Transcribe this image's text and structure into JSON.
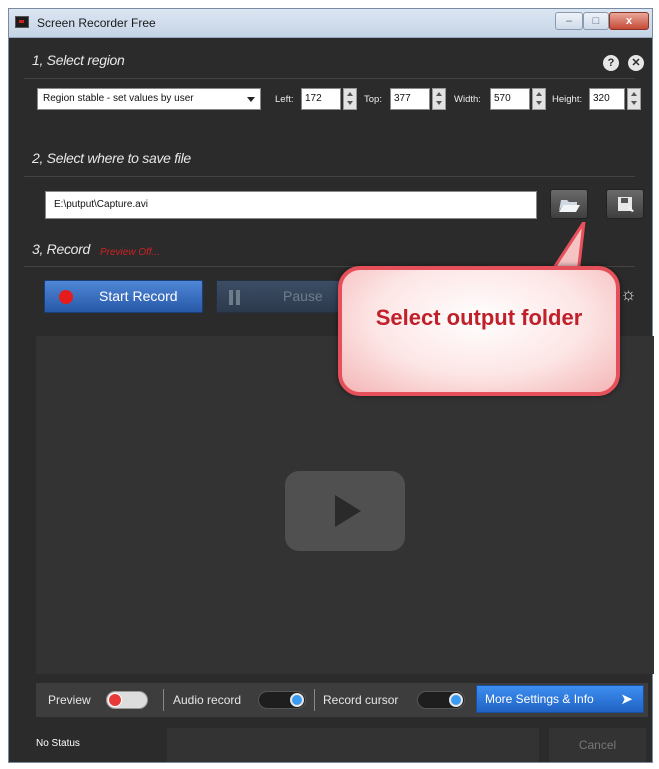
{
  "window": {
    "title": "Screen Recorder Free",
    "minimize_glyph": "–",
    "maximize_glyph": "□",
    "close_glyph": "x"
  },
  "section1": {
    "title": "1, Select region",
    "help_glyph": "?",
    "close_glyph": "✕",
    "region_mode": "Region stable - set values by user",
    "left_label": "Left:",
    "left_value": "172",
    "top_label": "Top:",
    "top_value": "377",
    "width_label": "Width:",
    "width_value": "570",
    "height_label": "Height:",
    "height_value": "320"
  },
  "section2": {
    "title": "2, Select where to save file",
    "path": "E:\\putput\\Capture.avi"
  },
  "section3": {
    "title": "3, Record",
    "preview_status": "Preview Off...",
    "start_label": "Start Record",
    "pause_label": "Pause",
    "settings_glyph": "☼"
  },
  "callout": {
    "text": "Select output folder"
  },
  "bottom": {
    "preview_label": "Preview",
    "audio_label": "Audio record",
    "cursor_label": "Record cursor",
    "more_label": "More Settings & Info",
    "more_glyph": "➤"
  },
  "status": {
    "text": "No Status",
    "cancel_label": "Cancel"
  },
  "colors": {
    "accent": "#2759a8",
    "record_dot": "#e61c1c",
    "callout_text": "#c0202a"
  }
}
